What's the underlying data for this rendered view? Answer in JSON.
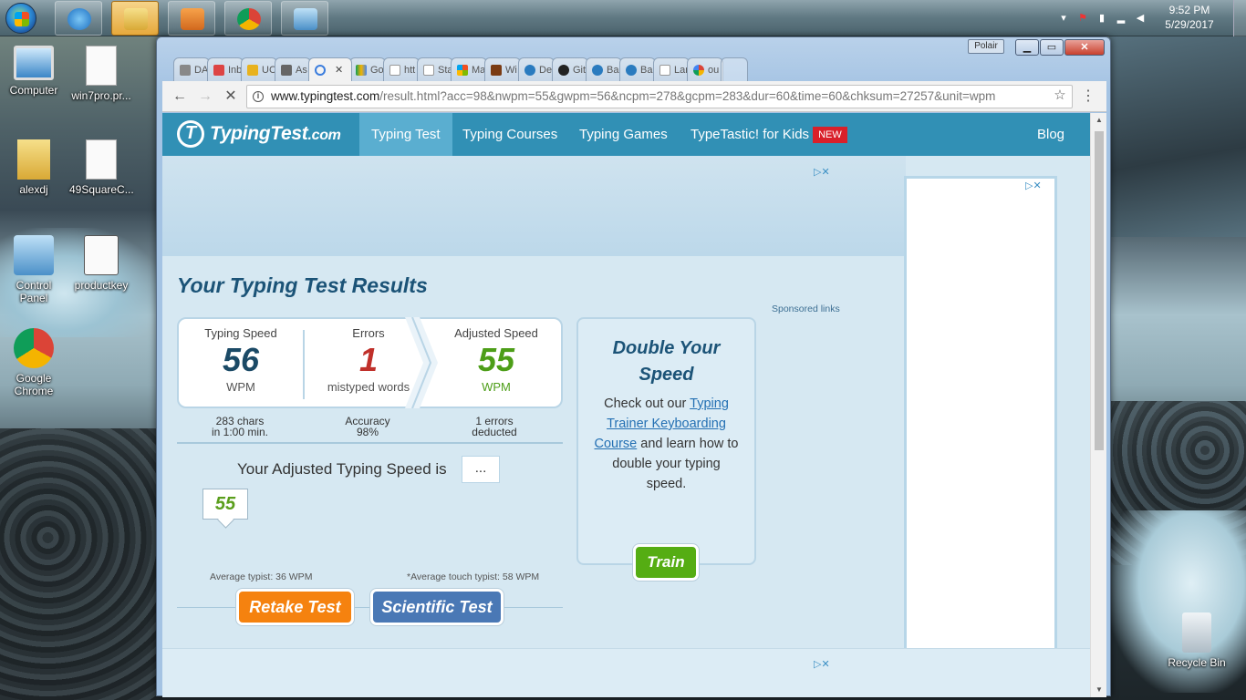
{
  "taskbar": {
    "clock_time": "9:52 PM",
    "clock_date": "5/29/2017",
    "apps": [
      {
        "name": "ie"
      },
      {
        "name": "explorer"
      },
      {
        "name": "media-player"
      },
      {
        "name": "chrome"
      },
      {
        "name": "control-panel"
      }
    ]
  },
  "desktop": {
    "icons": [
      {
        "label": "Computer"
      },
      {
        "label": "win7pro.pr..."
      },
      {
        "label": "alexdj"
      },
      {
        "label": "49SquareC..."
      },
      {
        "label": "Control Panel"
      },
      {
        "label": "productkey"
      },
      {
        "label": "Google Chrome"
      },
      {
        "label": "Recycle Bin"
      }
    ]
  },
  "browser": {
    "profile": "Polair",
    "tabs": [
      {
        "label": "DA"
      },
      {
        "label": "Inb"
      },
      {
        "label": "UC"
      },
      {
        "label": "As"
      },
      {
        "label": ""
      },
      {
        "label": "Go"
      },
      {
        "label": "htt"
      },
      {
        "label": "Sta"
      },
      {
        "label": "Ma"
      },
      {
        "label": "Wi"
      },
      {
        "label": "De"
      },
      {
        "label": "Git"
      },
      {
        "label": "Ba"
      },
      {
        "label": "Ba"
      },
      {
        "label": "Lar"
      },
      {
        "label": "ou"
      }
    ],
    "url_host": "www.typingtest.com",
    "url_rest": "/result.html?acc=98&nwpm=55&gwpm=56&ncpm=278&gcpm=283&dur=60&time=60&chksum=27257&unit=wpm"
  },
  "site": {
    "logo": "TypingTest",
    "logo_tld": ".com",
    "nav": [
      "Typing Test",
      "Typing Courses",
      "Typing Games",
      "TypeTastic! for Kids",
      "Blog"
    ],
    "nav_badge": "NEW",
    "title": "Your Typing Test Results",
    "sponsored": "Sponsored links",
    "stats": {
      "speed_label": "Typing Speed",
      "speed_value": "56",
      "speed_unit": "WPM",
      "errors_label": "Errors",
      "errors_value": "1",
      "errors_unit": "mistyped words",
      "adjusted_label": "Adjusted Speed",
      "adjusted_value": "55",
      "adjusted_unit": "WPM"
    },
    "sub": {
      "chars": "283 chars",
      "time": "in 1:00 min.",
      "accuracy_label": "Accuracy",
      "accuracy_value": "98%",
      "errors_deducted": "1 errors",
      "deducted": "deducted"
    },
    "adjusted_sentence": "Your Adjusted Typing Speed is",
    "adjusted_box": "...",
    "bubble_value": "55",
    "avg_typist": "Average typist: 36 WPM",
    "avg_touch": "*Average touch typist: 58 WPM",
    "retake": "Retake Test",
    "scientific": "Scientific Test",
    "promo": {
      "title": "Double Your Speed",
      "text_before": "Check out our",
      "link": "Typing Trainer Keyboarding Course",
      "text_after": "and learn how to double your typing speed.",
      "button": "Train"
    }
  },
  "colors": {
    "nav": "#3190b5",
    "speed": "#1b4a66",
    "errors": "#c0302a",
    "adjusted": "#4d9e18"
  }
}
